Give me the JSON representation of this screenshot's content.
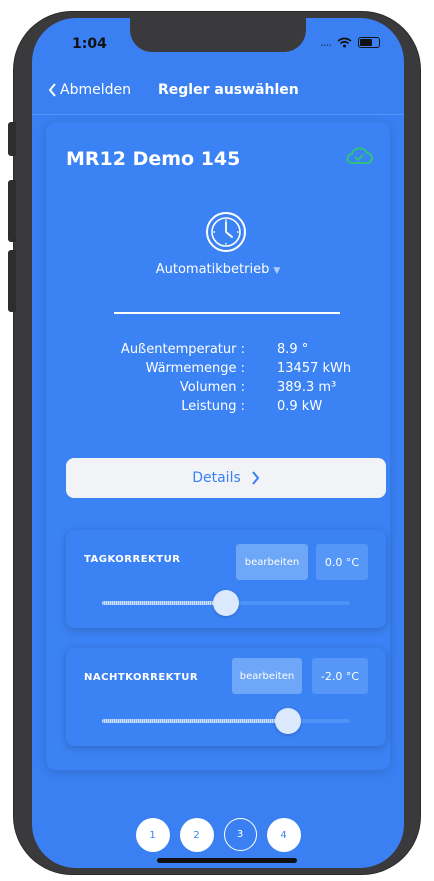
{
  "status": {
    "time": "1:04",
    "dots": "....",
    "wifi_icon": "wifi-icon",
    "battery_icon": "battery-icon"
  },
  "nav": {
    "back_label": "Abmelden",
    "title": "Regler auswählen"
  },
  "device": {
    "name": "MR12 Demo 145",
    "cloud_icon": "cloud-check-icon",
    "cloud_color": "#2ec27e",
    "mode_icon": "clock-icon",
    "mode": "Automatikbetrieb"
  },
  "info": [
    {
      "label": "Außentemperatur :",
      "value": "8.9 °"
    },
    {
      "label": "Wärmemenge :",
      "value": "13457 kWh"
    },
    {
      "label": "Volumen :",
      "value": "389.3 m³"
    },
    {
      "label": "Leistung :",
      "value": "0.9 kW"
    }
  ],
  "details_button": {
    "label": "Details",
    "icon": "chevron-right-icon"
  },
  "day_correction": {
    "title": "TAGKORREKTUR",
    "edit_label": "bearbeiten",
    "value": "0.0 °C",
    "slider_fraction": 0.5
  },
  "night_correction": {
    "title": "NACHTKORREKTUR",
    "edit_label": "bearbeiten",
    "value": "-2.0 °C",
    "slider_fraction": 0.75
  },
  "pager": {
    "pages": [
      "1",
      "2",
      "3",
      "4"
    ],
    "active_index": 2
  },
  "colors": {
    "background": "#3a80f2",
    "card": "#3b82f4",
    "accent_text": "#3a80f2"
  }
}
